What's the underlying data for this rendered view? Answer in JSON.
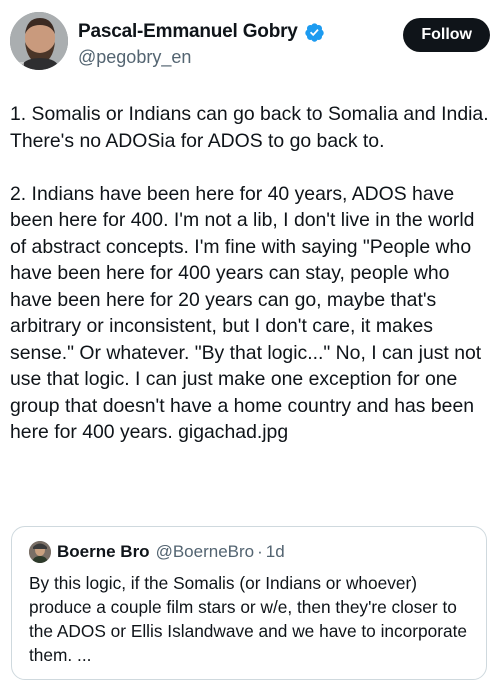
{
  "author": {
    "name": "Pascal-Emmanuel Gobry",
    "handle": "@pegobry_en",
    "verified": true,
    "verified_color": "#1d9bf0",
    "avatar_icon": "avatar-bearded-man"
  },
  "follow_button": {
    "label": "Follow"
  },
  "tweet": {
    "paragraphs": [
      "1. Somalis or Indians can go back to Somalia and India. There's no ADOSia for ADOS to go back to.",
      "2. Indians have been here for 40 years, ADOS have been here for 400. I'm not a lib, I don't live in the world of abstract concepts. I'm fine with saying \"People who have been here for 400 years can stay, people who have been here for 20 years can go, maybe that's arbitrary or inconsistent, but I don't care, it makes sense.\" Or whatever. \"By that logic...\" No, I can just not use that logic. I can just make one exception for one group that doesn't have a home country and has been here for 400 years. gigachad.jpg"
    ]
  },
  "quote": {
    "name": "Boerne Bro",
    "handle": "@BoerneBro",
    "dot": "·",
    "time": "1d",
    "text": "By this logic, if the Somalis (or Indians or whoever) produce a couple film stars or w/e, then they're closer to the ADOS or Ellis Islandwave and we have to incorporate them.  ..."
  },
  "colors": {
    "text_primary": "#0f1419",
    "text_secondary": "#536471",
    "border": "#cfd9de",
    "button_bg": "#0f1419"
  }
}
